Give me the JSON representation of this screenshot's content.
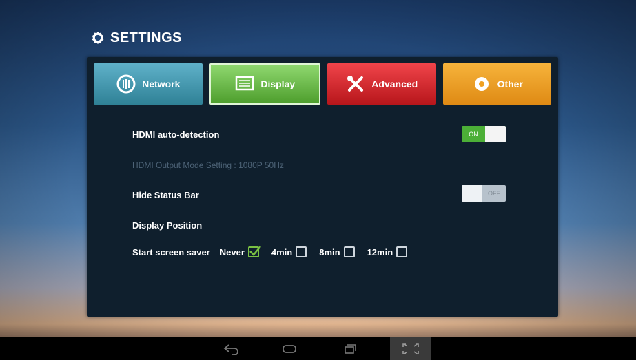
{
  "header": {
    "title": "SETTINGS",
    "icon": "gear-icon"
  },
  "tabs": [
    {
      "id": "network",
      "label": "Network",
      "icon": "network-icon",
      "color": "#3a9ab3"
    },
    {
      "id": "display",
      "label": "Display",
      "icon": "display-icon",
      "color": "#62b23f",
      "selected": true
    },
    {
      "id": "advanced",
      "label": "Advanced",
      "icon": "tools-icon",
      "color": "#d42127"
    },
    {
      "id": "other",
      "label": "Other",
      "icon": "other-icon",
      "color": "#f0a122"
    }
  ],
  "settings": {
    "hdmi_auto_detection": {
      "label": "HDMI auto-detection",
      "toggle_text": "ON",
      "state": "on"
    },
    "hdmi_output_mode": {
      "label": "HDMI Output Mode Setting :  1080P 50Hz"
    },
    "hide_status_bar": {
      "label": "Hide Status Bar",
      "toggle_text": "OFF",
      "state": "off"
    },
    "display_position": {
      "label": "Display Position"
    },
    "screen_saver": {
      "label": "Start screen saver",
      "options": [
        {
          "label": "Never",
          "checked": true
        },
        {
          "label": "4min",
          "checked": false
        },
        {
          "label": "8min",
          "checked": false
        },
        {
          "label": "12min",
          "checked": false
        }
      ]
    }
  },
  "navbar": {
    "buttons": [
      {
        "name": "back-icon"
      },
      {
        "name": "home-icon"
      },
      {
        "name": "recent-apps-icon"
      },
      {
        "name": "fullscreen-icon",
        "active": true
      }
    ]
  }
}
